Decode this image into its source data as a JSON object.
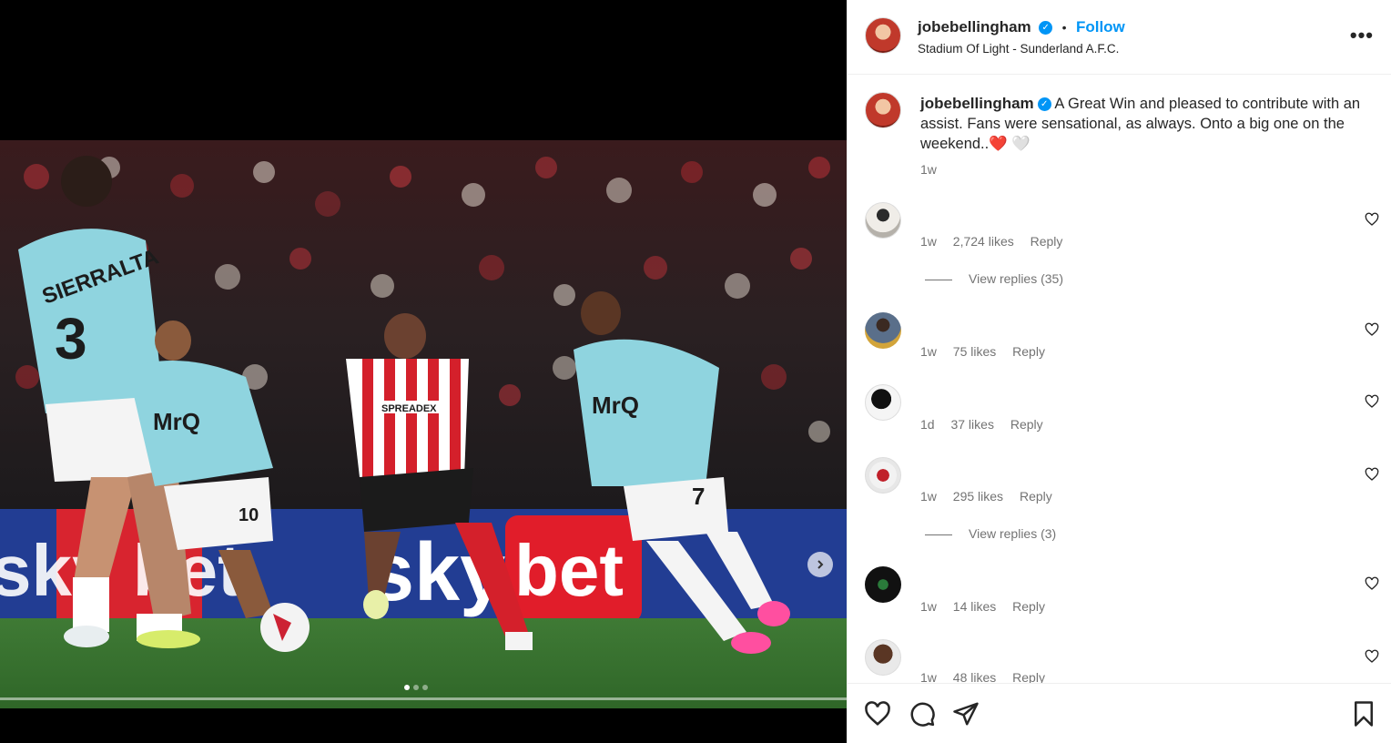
{
  "post": {
    "username": "jobebellingham",
    "dot": "•",
    "follow_label": "Follow",
    "location": "Stadium Of Light - Sunderland A.F.C.",
    "more_label": "•••"
  },
  "caption": {
    "username": "jobebellingham",
    "text": "A Great Win and pleased to contribute with an assist. Fans were sensational, as always. Onto a big one on the weekend..",
    "emoji": "❤️ 🤍",
    "time": "1w"
  },
  "comments": [
    {
      "time": "1w",
      "likes": "2,724 likes",
      "reply": "Reply",
      "view_replies": "View replies (35)"
    },
    {
      "time": "1w",
      "likes": "75 likes",
      "reply": "Reply"
    },
    {
      "time": "1d",
      "likes": "37 likes",
      "reply": "Reply"
    },
    {
      "time": "1w",
      "likes": "295 likes",
      "reply": "Reply",
      "view_replies": "View replies (3)"
    },
    {
      "time": "1w",
      "likes": "14 likes",
      "reply": "Reply"
    },
    {
      "time": "1w",
      "likes": "48 likes",
      "reply": "Reply"
    }
  ],
  "photo": {
    "ad_text": "sky bet",
    "ad_text_center": "sky",
    "ad_text_right": "bet",
    "sponsor": "MrQ",
    "player_name": "SIERRALTA",
    "number_left": "3",
    "number_mid": "10",
    "number_right": "7",
    "sponsor_red": "SPREADEX"
  },
  "carousel": {
    "count": 3,
    "active": 1
  },
  "colors": {
    "accent": "#0095f6",
    "text": "#262626",
    "muted": "#737373",
    "like_red": "#ed4956"
  }
}
